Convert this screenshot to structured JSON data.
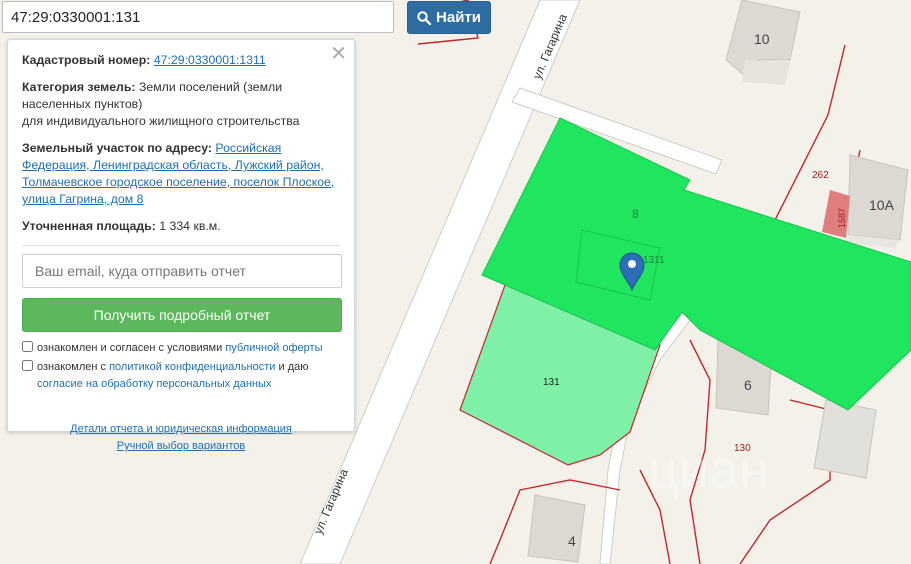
{
  "search": {
    "value": "47:29:0330001:131",
    "button_label": "Найти"
  },
  "panel": {
    "cadastral_label": "Кадастровый номер:",
    "cadastral_value": "47:29:0330001:1311",
    "category_label": "Категория земель:",
    "category_value": "Земли поселений (земли населенных пунктов)",
    "category_value_2": "для индивидуального жилищного строительства",
    "address_label": "Земельный участок по адресу:",
    "address_value": "Российская Федерация, Ленинградская область, Лужский район, Толмачевское городское поселение, поселок Плоское, улица Гагрина, дом 8",
    "area_label": "Уточненная площадь:",
    "area_value": "1 334 кв.м.",
    "email_placeholder": "Ваш email, куда отправить отчет",
    "report_button": "Получить подробный отчет",
    "consent1_prefix": "ознакомлен и согласен с условиями ",
    "consent1_link": "публичной оферты",
    "consent2_prefix": "ознакомлен с ",
    "consent2_link": "политикой конфиденциальности",
    "consent2_suffix": " и даю",
    "consent2_link2": "согласие на обработку персональных данных",
    "details_link": "Детали отчета и юридическая информация",
    "manual_link": "Ручной выбор вариантов"
  },
  "map": {
    "street_1": "ул. Гагарина",
    "street_2": "ул. Гагарина",
    "house_10": "10",
    "house_10a": "10А",
    "house_6": "6",
    "house_4": "4",
    "parcel_8": "8",
    "parcel_1311": "1311",
    "parcel_131": "131",
    "parcel_262": "262",
    "parcel_130": "130",
    "parcel_1587": "1587",
    "watermark": "циан"
  },
  "colors": {
    "selected_parcel": "#1fe65e",
    "neighbor_parcel": "#7ff0a8",
    "button_blue": "#2e6da4",
    "button_green": "#5cb85c",
    "border_red": "#c0282d"
  }
}
